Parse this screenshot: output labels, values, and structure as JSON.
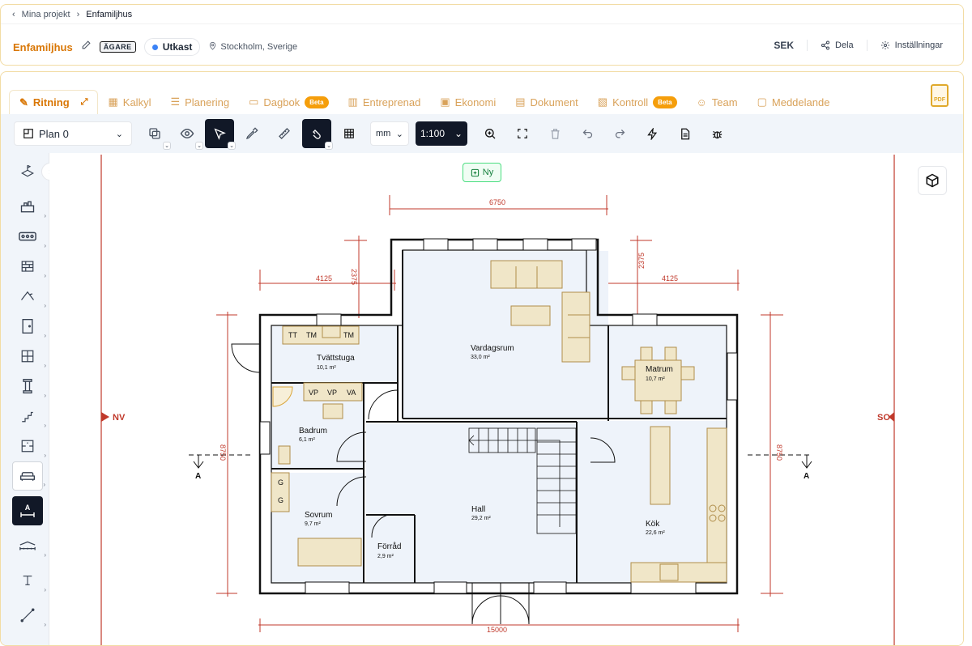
{
  "breadcrumb": {
    "back": "Mina projekt",
    "current": "Enfamiljhus"
  },
  "project": {
    "title": "Enfamiljhus",
    "role": "ÄGARE",
    "status": "Utkast",
    "location": "Stockholm, Sverige"
  },
  "actions": {
    "currency": "SEK",
    "share": "Dela",
    "settings": "Inställningar"
  },
  "tabs": [
    {
      "label": "Ritning",
      "active": true
    },
    {
      "label": "Kalkyl"
    },
    {
      "label": "Planering"
    },
    {
      "label": "Dagbok",
      "badge": "Beta"
    },
    {
      "label": "Entreprenad"
    },
    {
      "label": "Ekonomi"
    },
    {
      "label": "Dokument"
    },
    {
      "label": "Kontroll",
      "badge": "Beta"
    },
    {
      "label": "Team"
    },
    {
      "label": "Meddelande"
    }
  ],
  "pdf_label": "PDF",
  "toolbar": {
    "plan": "Plan 0",
    "unit": "mm",
    "scale": "1:100"
  },
  "sidebar_active_label": "A",
  "canvas": {
    "new_label": "Ny"
  },
  "plan": {
    "dims": {
      "top": "6750",
      "left": "4125",
      "right": "4125",
      "left_v": "2375",
      "right_v": "2375",
      "side_left": "8750",
      "side_right": "8750",
      "bottom": "15000"
    },
    "markers": {
      "west": "NV",
      "east": "SO",
      "section": "A"
    },
    "rooms": [
      {
        "name": "Tvättstuga",
        "area": "10,1 m²"
      },
      {
        "name": "Vardagsrum",
        "area": "33,0 m²"
      },
      {
        "name": "Matrum",
        "area": "10,7 m²"
      },
      {
        "name": "Badrum",
        "area": "6,1 m²"
      },
      {
        "name": "Sovrum",
        "area": "9,7 m²"
      },
      {
        "name": "Hall",
        "area": "29,2 m²"
      },
      {
        "name": "Förråd",
        "area": "2,9 m²"
      },
      {
        "name": "Kök",
        "area": "22,6 m²"
      }
    ],
    "appliances": {
      "tt": "TT",
      "tm": "TM",
      "vp": "VP",
      "va": "VA",
      "g": "G"
    }
  },
  "colors": {
    "accent": "#d97706",
    "dim": "#c0392b",
    "furniture": "#f0e6c8"
  }
}
